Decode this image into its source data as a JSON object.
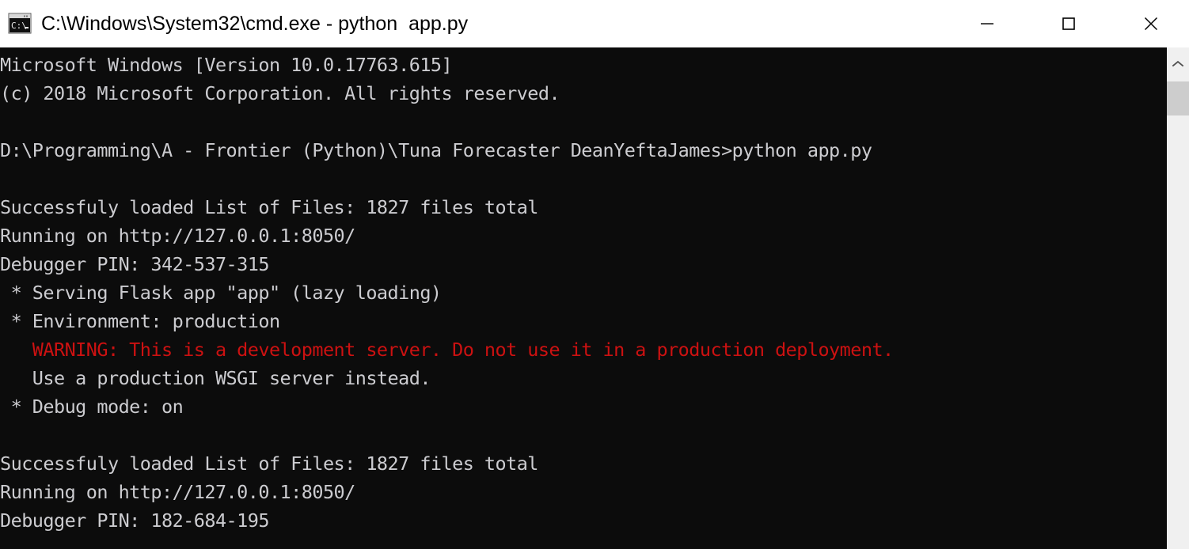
{
  "window": {
    "title": "C:\\Windows\\System32\\cmd.exe - python  app.py",
    "icon": "cmd-console-icon",
    "titlebar_background": "#ffffff",
    "titlebar_text_color": "#000000",
    "controls": [
      {
        "name": "minimize",
        "glyph": "—"
      },
      {
        "name": "maximize",
        "glyph": "□"
      },
      {
        "name": "close",
        "glyph": "✕"
      }
    ]
  },
  "terminal": {
    "background": "#0c0c0c",
    "foreground": "#ccccd0",
    "warning_color": "#cc1111",
    "lines": [
      {
        "text": "Microsoft Windows [Version 10.0.17763.615]",
        "color": "normal"
      },
      {
        "text": "(c) 2018 Microsoft Corporation. All rights reserved.",
        "color": "normal"
      },
      {
        "text": "",
        "color": "normal"
      },
      {
        "text": "D:\\Programming\\A - Frontier (Python)\\Tuna Forecaster DeanYeftaJames>python app.py",
        "color": "normal"
      },
      {
        "text": "",
        "color": "normal"
      },
      {
        "text": "Successfuly loaded List of Files: 1827 files total",
        "color": "normal"
      },
      {
        "text": "Running on http://127.0.0.1:8050/",
        "color": "normal"
      },
      {
        "text": "Debugger PIN: 342-537-315",
        "color": "normal"
      },
      {
        "text": " * Serving Flask app \"app\" (lazy loading)",
        "color": "normal"
      },
      {
        "text": " * Environment: production",
        "color": "normal"
      },
      {
        "text": "   WARNING: This is a development server. Do not use it in a production deployment.",
        "color": "warning"
      },
      {
        "text": "   Use a production WSGI server instead.",
        "color": "normal"
      },
      {
        "text": " * Debug mode: on",
        "color": "normal"
      },
      {
        "text": "",
        "color": "normal"
      },
      {
        "text": "Successfuly loaded List of Files: 1827 files total",
        "color": "normal"
      },
      {
        "text": "Running on http://127.0.0.1:8050/",
        "color": "normal"
      },
      {
        "text": "Debugger PIN: 182-684-195",
        "color": "normal"
      }
    ]
  },
  "scrollbar": {
    "track_color": "#f0f0f0",
    "thumb_color": "#cdcdcd",
    "up_arrow": "scroll-up-arrow-icon"
  }
}
